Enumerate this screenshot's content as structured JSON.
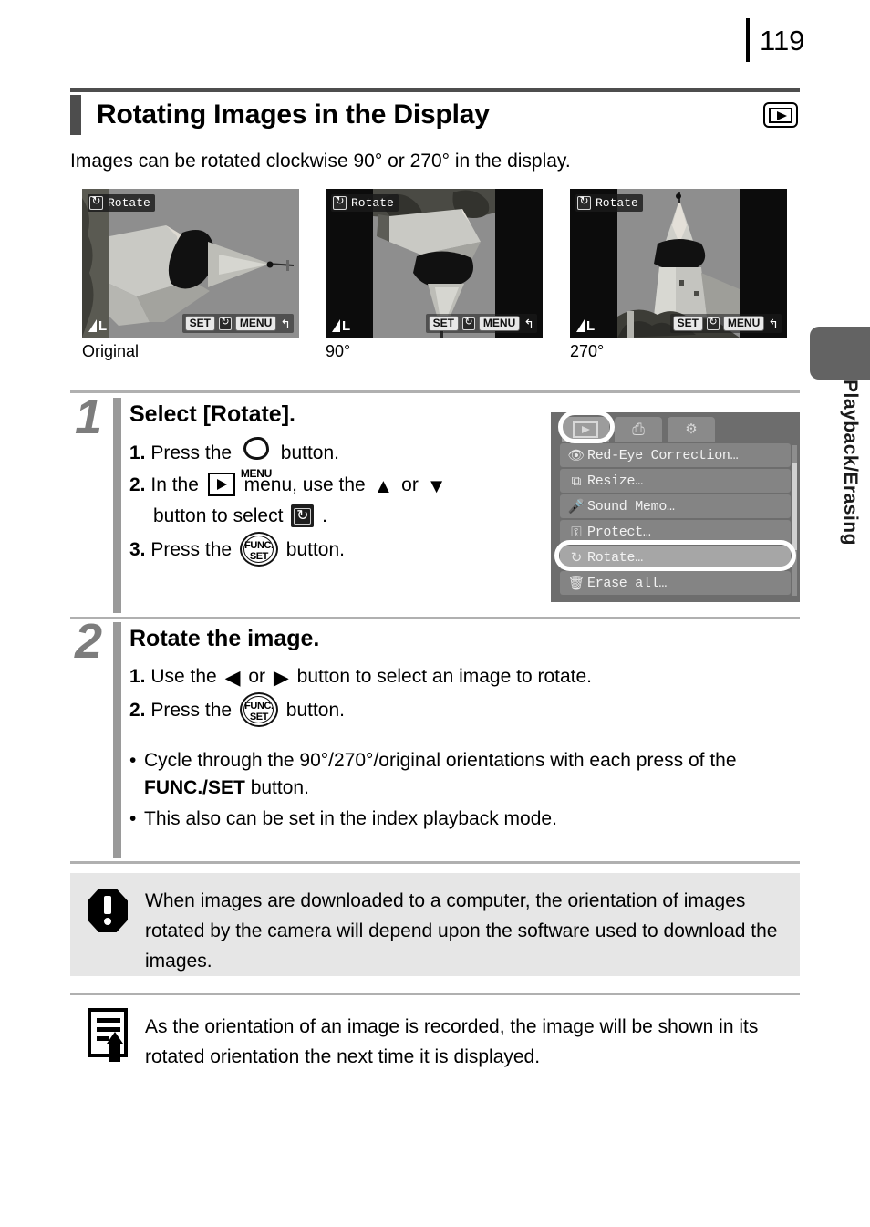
{
  "page": {
    "number": "119",
    "title": "Rotating Images in the Display",
    "title_mode_icon": "playback-icon",
    "intro": "Images can be rotated clockwise 90° or 270° in the display."
  },
  "side_tab": {
    "label": "Playback/Erasing"
  },
  "samples": [
    {
      "caption": "Original",
      "osd_label": "Rotate",
      "osd_icon": "rotate-icon",
      "quality": "L",
      "controls": {
        "set": "SET",
        "icon": "rotate-icon",
        "menu": "MENU",
        "back": "↰"
      },
      "orientation": "original"
    },
    {
      "caption": "90°",
      "osd_label": "Rotate",
      "osd_icon": "rotate-icon",
      "quality": "L",
      "controls": {
        "set": "SET",
        "icon": "rotate-icon",
        "menu": "MENU",
        "back": "↰"
      },
      "orientation": "90"
    },
    {
      "caption": "270°",
      "osd_label": "Rotate",
      "osd_icon": "rotate-icon",
      "quality": "L",
      "controls": {
        "set": "SET",
        "icon": "rotate-icon",
        "menu": "MENU",
        "back": "↰"
      },
      "orientation": "270"
    }
  ],
  "steps": [
    {
      "number": "1",
      "heading": "Select [Rotate].",
      "items": {
        "n1": "1.",
        "t1a": "Press the",
        "t1b": "button.",
        "n2": "2.",
        "t2a": "In the",
        "t2b": "menu, use the",
        "t2c": "or",
        "t2d": "button to select",
        "t2e": ".",
        "n3": "3.",
        "t3a": "Press the",
        "t3b": "button."
      },
      "glyph_menu_label": "MENU",
      "glyph_func": "FUNC.",
      "glyph_set": "SET",
      "arrow_up": "▲",
      "arrow_down": "▼"
    },
    {
      "number": "2",
      "heading": "Rotate the image.",
      "items": {
        "n1": "1.",
        "t1a": "Use the",
        "t1b": "or",
        "t1c": "button to select an image to rotate.",
        "n2": "2.",
        "t2a": "Press the",
        "t2b": "button."
      },
      "arrow_left": "◀",
      "arrow_right": "▶",
      "bullets": [
        {
          "dot": "•",
          "text_before": "Cycle through the 90°/270°/original orientations with each press of the",
          "bold": "FUNC./SET",
          "text_after": "button."
        },
        {
          "dot": "•",
          "text_before": "This also can be set in the index playback mode.",
          "bold": "",
          "text_after": ""
        }
      ]
    }
  ],
  "camera_menu": {
    "tabs": [
      {
        "name": "playback-tab",
        "glyph": "▶",
        "selected": true
      },
      {
        "name": "print-tab",
        "glyph": "⎙",
        "selected": false
      },
      {
        "name": "settings-tab",
        "glyph": "⚙",
        "selected": false
      }
    ],
    "rows": [
      {
        "icon": "red-eye-icon",
        "glyph": "👁",
        "label": "Red-Eye Correction…",
        "active": false
      },
      {
        "icon": "resize-icon",
        "glyph": "⧉",
        "label": "Resize…",
        "active": false
      },
      {
        "icon": "sound-memo-icon",
        "glyph": "🎤",
        "label": "Sound Memo…",
        "active": false
      },
      {
        "icon": "protect-icon",
        "glyph": "⚿",
        "label": "Protect…",
        "active": false
      },
      {
        "icon": "rotate-icon",
        "glyph": "↻",
        "label": "Rotate…",
        "active": true
      },
      {
        "icon": "erase-all-icon",
        "glyph": "🗑",
        "label": "Erase all…",
        "active": false
      }
    ]
  },
  "notes": {
    "warning": {
      "icon": "exclamation-icon",
      "text": "When images are downloaded to a computer, the orientation of images rotated by the camera will depend upon the software used to download the images."
    },
    "memo": {
      "icon": "memo-pencil-icon",
      "text": "As the orientation of an image is recorded, the image will be shown in its rotated orientation the next time it is displayed."
    }
  },
  "colors": {
    "title_bar": "#4d4d4d",
    "step_rail": "#9a9a9a",
    "warning_bg": "#e6e6e6",
    "side_tab": "#636363"
  }
}
